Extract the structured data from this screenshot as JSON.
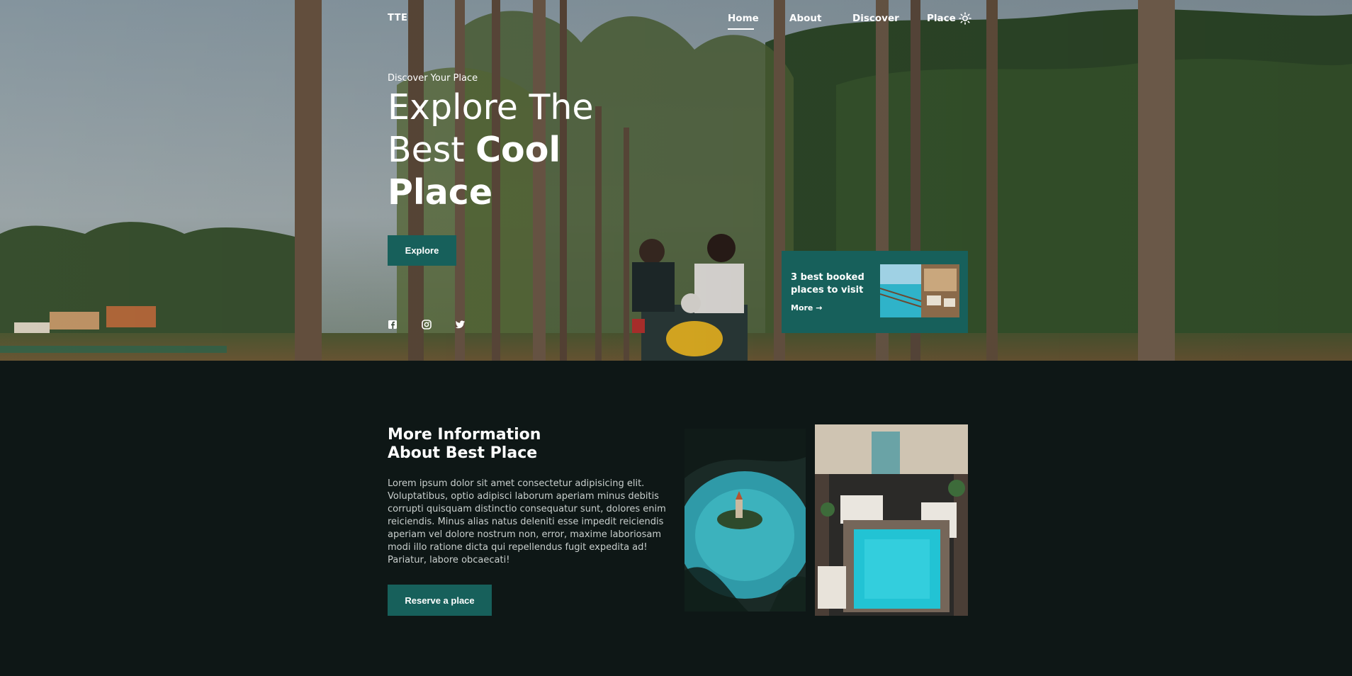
{
  "nav": {
    "logo": "TTE",
    "links": [
      "Home",
      "About",
      "Discover",
      "Place"
    ],
    "active_link": "Home",
    "theme_toggle_icon": "sun-icon"
  },
  "hero": {
    "subtitle": "Discover Your Place",
    "headline_line1": "Explore The",
    "headline_line2_regular": "Best ",
    "headline_line2_bold": "Cool",
    "headline_line3_bold": "Place",
    "explore_label": "Explore",
    "social_icons": [
      "facebook-icon",
      "instagram-icon",
      "twitter-icon"
    ]
  },
  "booked_card": {
    "title": "3 best booked places to visit",
    "more_label": "More",
    "more_icon": "arrow-right-icon"
  },
  "info": {
    "title_line1": "More Information",
    "title_line2": "About Best Place",
    "text": "Lorem ipsum dolor sit amet consectetur adipisicing elit. Voluptatibus, optio adipisci laborum aperiam minus debitis corrupti quisquam distinctio consequatur sunt, dolores enim reiciendis. Minus alias natus deleniti esse impedit reiciendis aperiam vel dolore nostrum non, error, maxime laboriosam modi illo ratione dicta qui repellendus fugit expedita ad! Pariatur, labore obcaecati!",
    "reserve_label": "Reserve a place"
  },
  "colors": {
    "accent": "#17605b",
    "page_background": "#0e1716",
    "text_primary": "#ffffff",
    "text_muted": "#c9cfcd"
  }
}
